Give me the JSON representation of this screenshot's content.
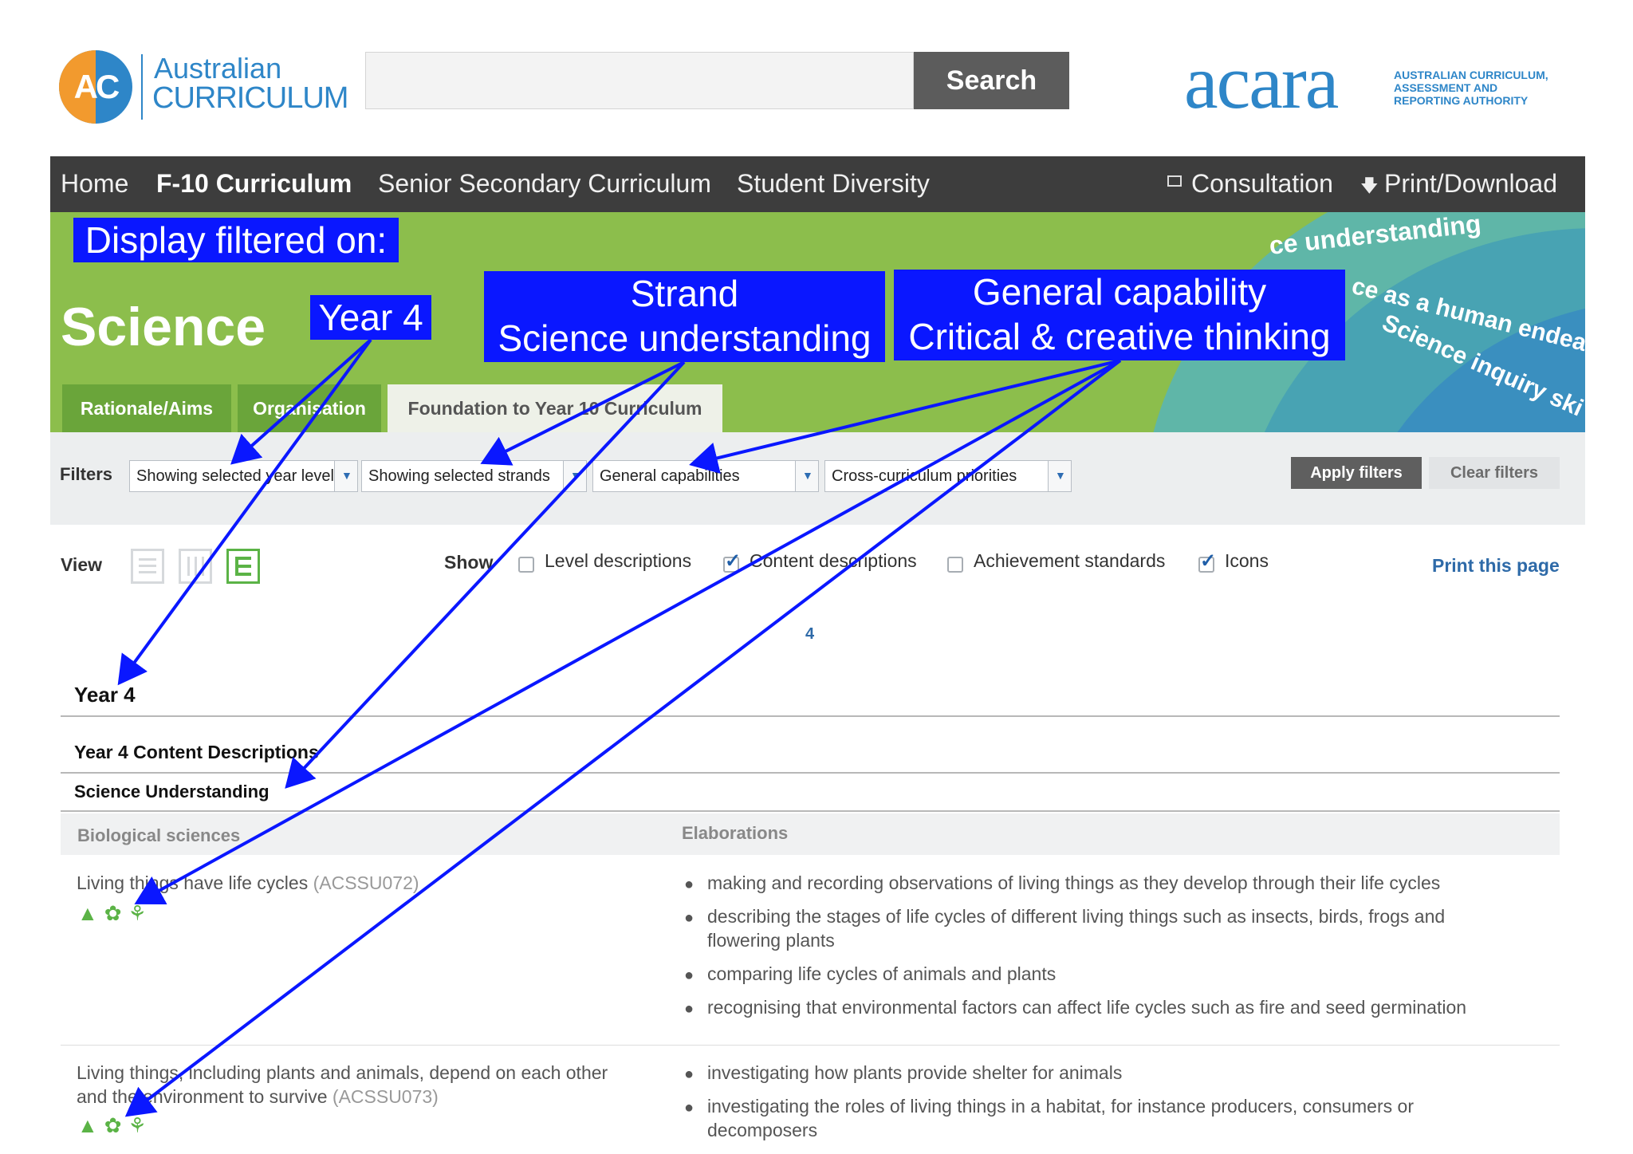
{
  "header": {
    "logo_initials": "AC",
    "logo_line1": "Australian",
    "logo_line2": "CURRICULUM",
    "search_button": "Search",
    "search_placeholder": "",
    "acara_logo": "acara",
    "acara_sub_line1": "AUSTRALIAN CURRICULUM,",
    "acara_sub_line2": "ASSESSMENT AND",
    "acara_sub_line3": "REPORTING AUTHORITY"
  },
  "nav": {
    "home": "Home",
    "f10": "F-10 Curriculum",
    "senior": "Senior Secondary Curriculum",
    "diversity": "Student Diversity",
    "consultation_icon": "window-icon",
    "consultation": "Consultation",
    "print_icon": "download-arrow-icon",
    "print": "Print/Download"
  },
  "banner": {
    "title": "Science",
    "arc_text_1": "ce understanding",
    "arc_text_2": "ce as a human endea",
    "arc_text_3": "Science inquiry ski",
    "tabs": [
      {
        "label": "Rationale/Aims",
        "active": false
      },
      {
        "label": "Organisation",
        "active": false
      },
      {
        "label": "Foundation to Year 10 Curriculum",
        "active": true
      }
    ]
  },
  "filters": {
    "label": "Filters",
    "year_levels": "Showing selected year levels",
    "strands": "Showing selected strands",
    "general_capabilities": "General capabilities",
    "cross_curriculum": "Cross-curriculum priorities",
    "apply": "Apply filters",
    "clear": "Clear filters"
  },
  "view": {
    "label": "View",
    "show_label": "Show",
    "level_descriptions": {
      "label": "Level descriptions",
      "checked": false
    },
    "content_descriptions": {
      "label": "Content descriptions",
      "checked": true
    },
    "achievement_standards": {
      "label": "Achievement standards",
      "checked": false
    },
    "icons": {
      "label": "Icons",
      "checked": true
    },
    "print_page": "Print this page",
    "level_number": "4"
  },
  "content": {
    "year_heading": "Year 4",
    "content_heading": "Year 4 Content Descriptions",
    "strand_heading": "Science Understanding",
    "column_left": "Biological sciences",
    "column_right": "Elaborations",
    "rows": [
      {
        "desc": "Living things have life cycles",
        "code": "(ACSSU072)",
        "icons": "graduation-cap-icon gear-icon sprout-icon",
        "elaborations": [
          "making and recording observations of living things as they develop through their life cycles",
          "describing the stages of life cycles of different living things such as insects, birds, frogs and",
          "flowering plants",
          "comparing life cycles of animals and plants",
          "recognising that environmental factors can affect life cycles such as fire and seed germination"
        ]
      },
      {
        "desc_line1": "Living things, including plants and animals, depend on each other",
        "desc_line2": "and the environment to survive",
        "code": "(ACSSU073)",
        "elaborations": [
          "investigating how plants provide shelter for animals",
          "investigating the roles of living things in a habitat, for instance producers, consumers or",
          "decomposers"
        ]
      }
    ]
  },
  "annotations": {
    "display_filtered": "Display filtered on:",
    "year": "Year 4",
    "strand_line1": "Strand",
    "strand_line2": "Science understanding",
    "gc_line1": "General capability",
    "gc_line2": "Critical & creative thinking",
    "color": "#0a17ff"
  },
  "colors": {
    "brand_blue": "#2e86c8",
    "banner_green": "#8cbe4c",
    "tab_green": "#6aa53a",
    "icon_green": "#5bb346",
    "nav_dark": "#3d3d3d"
  }
}
